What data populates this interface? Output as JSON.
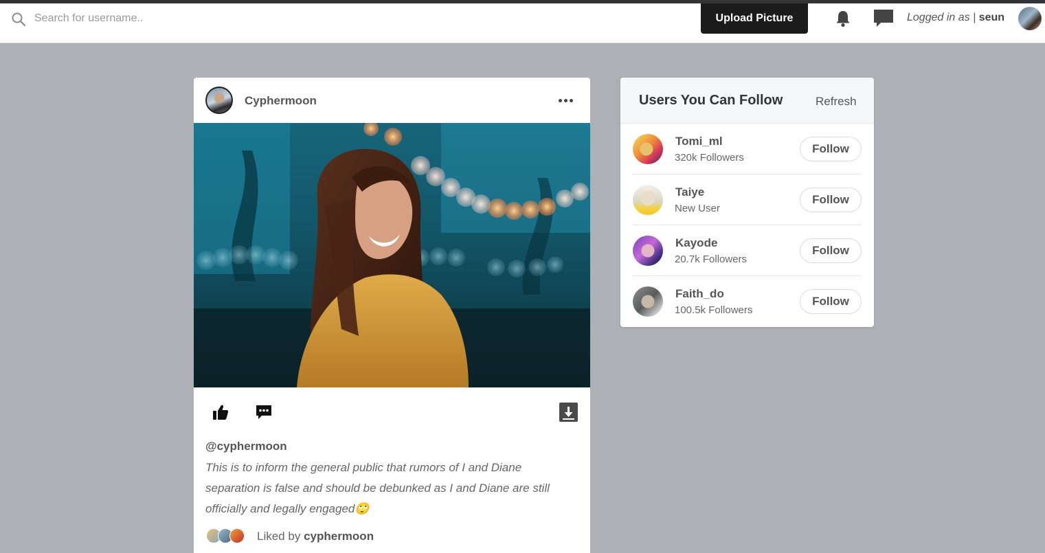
{
  "header": {
    "search_placeholder": "Search for username..",
    "upload_label": "Upload Picture",
    "logged_in_prefix": "Logged in as |",
    "username": "seun"
  },
  "post": {
    "author": "Cyphermoon",
    "handle": "@cyphermoon",
    "caption": "This is to inform the general public that rumors of I and Diane separation is false and should be debunked as I and Diane are still officially and legally engaged🙄",
    "liked_by_prefix": "Liked by",
    "liked_by_user": "cyphermoon"
  },
  "suggestions": {
    "title": "Users You Can Follow",
    "refresh_label": "Refresh",
    "follow_label": "Follow",
    "users": [
      {
        "name": "Tomi_ml",
        "sub": "320k Followers"
      },
      {
        "name": "Taiye",
        "sub": "New User"
      },
      {
        "name": "Kayode",
        "sub": "20.7k Followers"
      },
      {
        "name": "Faith_do",
        "sub": "100.5k Followers"
      }
    ]
  },
  "icons": {
    "search": "search-icon",
    "notifications": "bell-icon",
    "messages": "chat-icon",
    "like": "thumbs-up-icon",
    "comment": "comment-icon",
    "download": "download-icon",
    "more": "more-options-icon"
  },
  "colors": {
    "page_background": "#adb0b5",
    "upload_button": "#1b1b1b",
    "card_background": "#ffffff"
  }
}
